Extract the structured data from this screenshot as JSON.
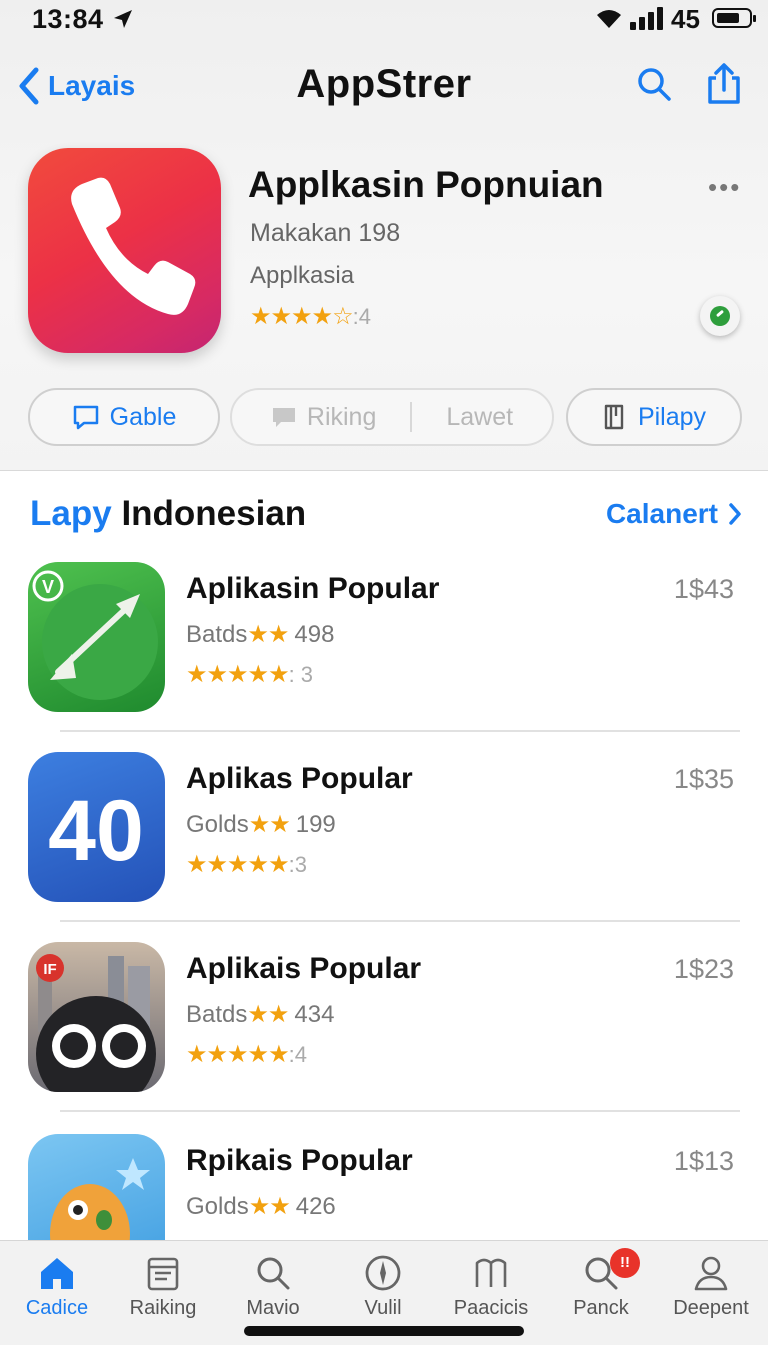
{
  "status": {
    "time": "13:84",
    "battery": "45"
  },
  "nav": {
    "back_label": "Layais",
    "title": "AppStrer"
  },
  "hero": {
    "title": "Applkasin Popnuian",
    "subtitle": "Makakan 198",
    "category": "Applkasia",
    "stars": "★★★★☆",
    "rating_count": ":4",
    "more": "•••"
  },
  "actions": {
    "left": "Gable",
    "middle_a": "Riking",
    "middle_b": "Lawet",
    "right": "Pilapy"
  },
  "section": {
    "title_accent": "Lapy",
    "title_rest": "Indonesian",
    "link": "Calanert"
  },
  "apps": [
    {
      "name": "Aplikasin Popular",
      "meta": "Batds",
      "count": "498",
      "stars": "★★★★★",
      "rating": ": 3",
      "price": "1$43",
      "icon_badge": "V"
    },
    {
      "name": "Aplikas Popular",
      "meta": "Golds",
      "count": "199",
      "stars": "★★★★★",
      "rating": ":3",
      "price": "1$35",
      "icon_text": "40"
    },
    {
      "name": "Aplikais Popular",
      "meta": "Batds",
      "count": "434",
      "stars": "★★★★★",
      "rating": ":4",
      "price": "1$23",
      "icon_badge": "IF"
    },
    {
      "name": "Rpikais Popular",
      "meta": "Golds",
      "count": "426",
      "stars": "",
      "rating": "",
      "price": "1$13"
    }
  ],
  "meta_stars": "★★",
  "tabs": [
    {
      "label": "Cadice",
      "icon": "home-icon",
      "active": true
    },
    {
      "label": "Raiking",
      "icon": "calendar-icon"
    },
    {
      "label": "Mavio",
      "icon": "search-icon"
    },
    {
      "label": "Vulil",
      "icon": "compass-icon"
    },
    {
      "label": "Paacicis",
      "icon": "books-icon"
    },
    {
      "label": "Panck",
      "icon": "magnify-icon",
      "badge": "!!"
    },
    {
      "label": "Deepent",
      "icon": "person-icon"
    }
  ],
  "colors": {
    "accent": "#1a7cf0",
    "star": "#f2a10f",
    "badge": "#e8332a"
  }
}
